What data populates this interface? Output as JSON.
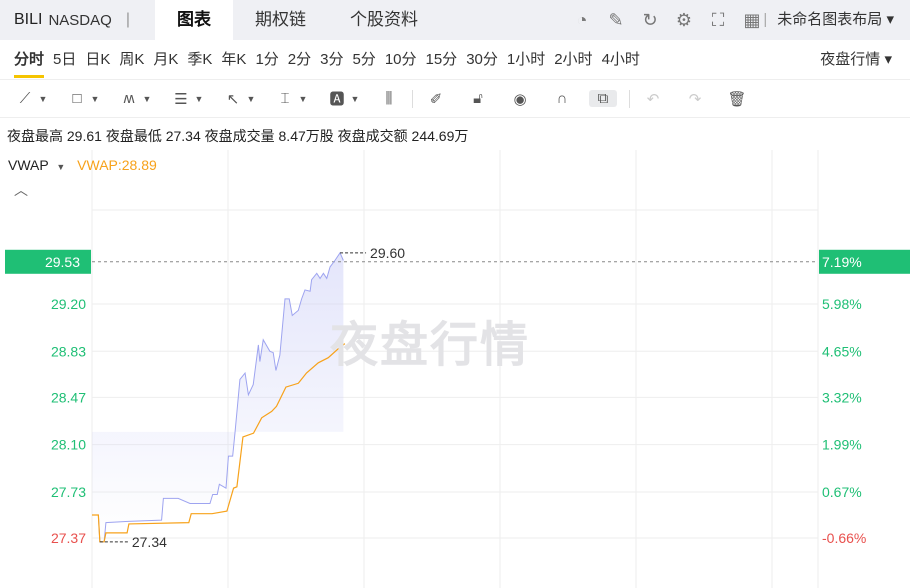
{
  "header": {
    "symbol": "BILI",
    "exchange": "NASDAQ",
    "separator": "|",
    "tabs": [
      "图表",
      "期权链",
      "个股资料"
    ],
    "icons": [
      "gauge-icon",
      "edit-icon",
      "refresh-icon",
      "settings-icon",
      "fullscreen-icon",
      "grid-layout-icon"
    ],
    "layout_label": "未命名图表布局 ▾"
  },
  "periods": {
    "items": [
      "分时",
      "5日",
      "日K",
      "周K",
      "月K",
      "季K",
      "年K",
      "1分",
      "2分",
      "3分",
      "5分",
      "10分",
      "15分",
      "30分",
      "1小时",
      "2小时",
      "4小时"
    ],
    "active": "分时",
    "session_label": "夜盘行情 ▾"
  },
  "stats": {
    "text": "夜盘最高 29.61 夜盘最低 27.34 夜盘成交量 8.47万股 夜盘成交额 244.69万"
  },
  "indicator": {
    "name": "VWAP",
    "value_label": "VWAP:28.89"
  },
  "watermark": "夜盘行情",
  "colors": {
    "up": "#1fbf75",
    "down": "#e8504d",
    "price_line": "#9ea4f0",
    "vwap": "#f7a21b",
    "badge": "#1fbf75"
  },
  "chart_data": {
    "type": "line",
    "prev_close": 27.55,
    "current_price": 29.53,
    "current_change": "7.19%",
    "high_label": "29.60",
    "low_label": "27.34",
    "y_ticks": [
      {
        "price": "29.20",
        "pct": "5.98%"
      },
      {
        "price": "28.83",
        "pct": "4.65%"
      },
      {
        "price": "28.47",
        "pct": "3.32%"
      },
      {
        "price": "28.10",
        "pct": "1.99%"
      },
      {
        "price": "27.73",
        "pct": "0.67%"
      },
      {
        "price": "27.37",
        "pct": "-0.66%"
      }
    ],
    "x_range": [
      0,
      240
    ],
    "series": [
      {
        "name": "price",
        "points": [
          [
            0,
            27.55
          ],
          [
            2.1,
            27.55
          ],
          [
            2.6,
            27.34
          ],
          [
            4,
            27.34
          ],
          [
            4.6,
            27.49
          ],
          [
            12,
            27.5
          ],
          [
            23,
            27.51
          ],
          [
            23.6,
            27.68
          ],
          [
            28.5,
            27.68
          ],
          [
            32.4,
            27.64
          ],
          [
            39,
            27.64
          ],
          [
            39.9,
            27.71
          ],
          [
            41.4,
            27.71
          ],
          [
            42.1,
            27.79
          ],
          [
            44.3,
            27.76
          ],
          [
            45.1,
            28.01
          ],
          [
            46.5,
            28.01
          ],
          [
            47.3,
            28.2
          ],
          [
            48.9,
            28.61
          ],
          [
            50.6,
            28.66
          ],
          [
            51.7,
            28.49
          ],
          [
            53.3,
            28.57
          ],
          [
            55,
            28.88
          ],
          [
            55.5,
            28.75
          ],
          [
            56.6,
            28.92
          ],
          [
            58.8,
            28.83
          ],
          [
            59.9,
            28.82
          ],
          [
            60.8,
            28.68
          ],
          [
            62.1,
            28.8
          ],
          [
            63.8,
            29.24
          ],
          [
            65.2,
            29.24
          ],
          [
            66.2,
            29.11
          ],
          [
            68.2,
            29.15
          ],
          [
            69.3,
            29.24
          ],
          [
            70.4,
            29.31
          ],
          [
            72.1,
            29.3
          ],
          [
            72.6,
            29.39
          ],
          [
            74.3,
            29.44
          ],
          [
            75.4,
            29.4
          ],
          [
            76.5,
            29.44
          ],
          [
            77.6,
            29.4
          ],
          [
            78.7,
            29.49
          ],
          [
            80.3,
            29.54
          ],
          [
            82,
            29.6
          ],
          [
            83.1,
            29.54
          ]
        ]
      },
      {
        "name": "VWAP",
        "points": [
          [
            0,
            27.55
          ],
          [
            2.1,
            27.55
          ],
          [
            2.6,
            27.34
          ],
          [
            4,
            27.34
          ],
          [
            4.6,
            27.41
          ],
          [
            11.6,
            27.41
          ],
          [
            12.2,
            27.48
          ],
          [
            32,
            27.49
          ],
          [
            32.8,
            27.56
          ],
          [
            39.7,
            27.56
          ],
          [
            44.6,
            27.58
          ],
          [
            46.8,
            27.76
          ],
          [
            47.9,
            27.77
          ],
          [
            49.9,
            28.16
          ],
          [
            53.4,
            28.19
          ],
          [
            56.1,
            28.31
          ],
          [
            59.4,
            28.36
          ],
          [
            61,
            28.4
          ],
          [
            64.1,
            28.55
          ],
          [
            68.2,
            28.58
          ],
          [
            70.9,
            28.66
          ],
          [
            74.8,
            28.74
          ],
          [
            78.1,
            28.78
          ],
          [
            81.4,
            28.85
          ],
          [
            83.6,
            28.89
          ]
        ]
      }
    ]
  }
}
